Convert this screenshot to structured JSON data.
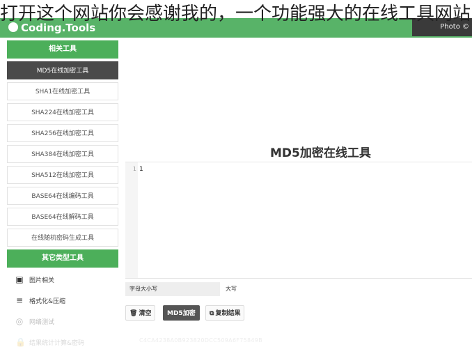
{
  "overlay_caption": "打开这个网站你会感谢我的，一个功能强大的在线工具网站",
  "header": {
    "logo_text": "Coding.Tools",
    "photo_tag": "Photo ©"
  },
  "sidebar": {
    "related_heading": "相关工具",
    "items": [
      {
        "label": "MD5在线加密工具",
        "active": true
      },
      {
        "label": "SHA1在线加密工具",
        "active": false
      },
      {
        "label": "SHA224在线加密工具",
        "active": false
      },
      {
        "label": "SHA256在线加密工具",
        "active": false
      },
      {
        "label": "SHA384在线加密工具",
        "active": false
      },
      {
        "label": "SHA512在线加密工具",
        "active": false
      },
      {
        "label": "BASE64在线编码工具",
        "active": false
      },
      {
        "label": "BASE64在线解码工具",
        "active": false
      },
      {
        "label": "在线随机密码生成工具",
        "active": false
      }
    ],
    "other_heading": "其它类型工具",
    "other_items": [
      {
        "icon": "image-icon",
        "glyph": "▣",
        "label": "图片相关"
      },
      {
        "icon": "format-icon",
        "glyph": "≡",
        "label": "格式化&压缩"
      },
      {
        "icon": "network-icon",
        "glyph": "◎",
        "label": "网络测试"
      },
      {
        "icon": "lock-icon",
        "glyph": "🔒",
        "label": "结果统计计算&密码"
      }
    ]
  },
  "main": {
    "title": "MD5加密在线工具",
    "editor_line_number": "1",
    "editor_content": "1",
    "case_label": "字母大小写",
    "case_value": "大写",
    "buttons": {
      "clear": "清空",
      "md5": "MD5加密",
      "copy": "复制结果"
    },
    "result_line_number": "1",
    "result_value": "C4CA4238A0B923820DCC509A6F75849B"
  },
  "colors": {
    "green": "#4caf5a",
    "dark": "#4a4a4a"
  }
}
